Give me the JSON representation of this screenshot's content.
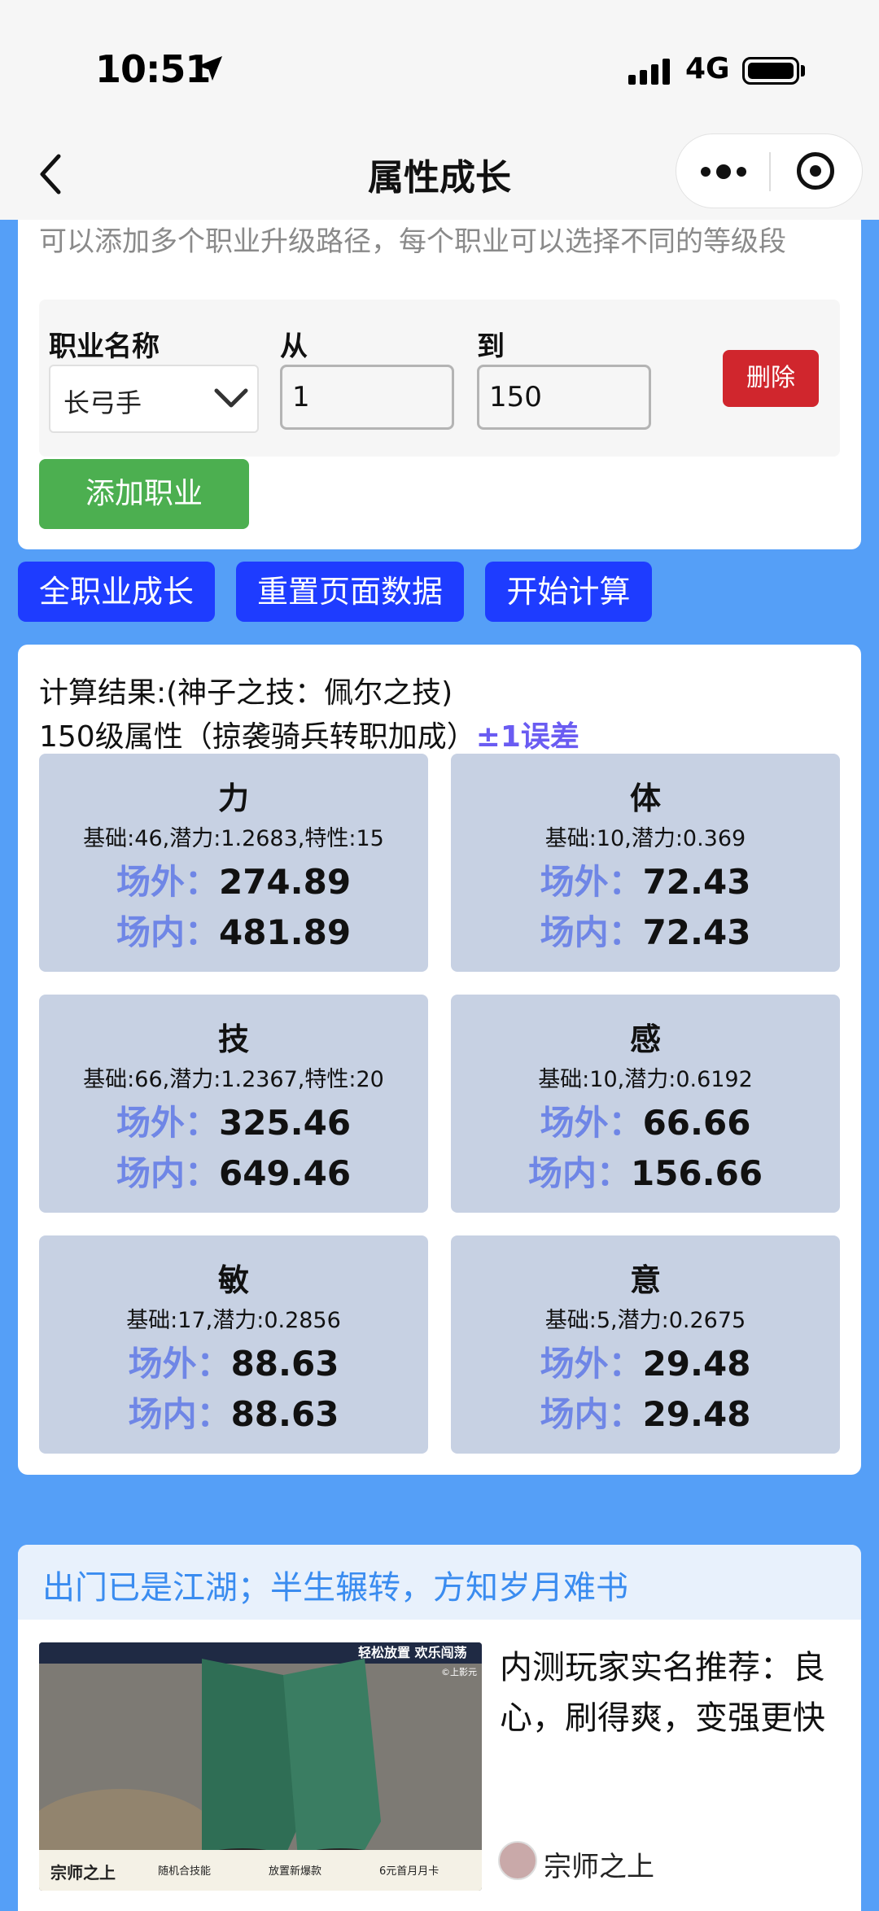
{
  "status_bar": {
    "time": "10:51",
    "network": "4G"
  },
  "nav": {
    "title": "属性成长"
  },
  "form": {
    "description": "可以添加多个职业升级路径，每个职业可以选择不同的等级段",
    "job_label": "职业名称",
    "from_label": "从",
    "to_label": "到",
    "job_value": "长弓手",
    "from_value": "1",
    "to_value": "150",
    "delete_label": "删除",
    "add_label": "添加职业"
  },
  "actions": {
    "all_growth": "全职业成长",
    "reset": "重置页面数据",
    "calculate": "开始计算"
  },
  "result": {
    "line1": "计算结果:(神子之技：佩尔之技)",
    "line2": "150级属性（掠袭骑兵转职加成）",
    "error_note": "±1误差",
    "outside_label": "场外：",
    "inside_label": "场内：",
    "stats": [
      {
        "name": "力",
        "base": "基础:46,潜力:1.2683,特性:15",
        "outside": "274.89",
        "inside": "481.89"
      },
      {
        "name": "体",
        "base": "基础:10,潜力:0.369",
        "outside": "72.43",
        "inside": "72.43"
      },
      {
        "name": "技",
        "base": "基础:66,潜力:1.2367,特性:20",
        "outside": "325.46",
        "inside": "649.46"
      },
      {
        "name": "感",
        "base": "基础:10,潜力:0.6192",
        "outside": "66.66",
        "inside": "156.66"
      },
      {
        "name": "敏",
        "base": "基础:17,潜力:0.2856",
        "outside": "88.63",
        "inside": "88.63"
      },
      {
        "name": "意",
        "base": "基础:5,潜力:0.2675",
        "outside": "29.48",
        "inside": "29.48"
      }
    ]
  },
  "ad": {
    "heading": "出门已是江湖；半生辗转，方知岁月难书",
    "text": "内测玩家实名推荐：良心，刷得爽，变强更快",
    "author": "宗师之上",
    "image_texts": [
      "轻松放置 欢乐闯荡",
      "宗师之上",
      "随机合技能",
      "放置新爆款",
      "6元首月月卡",
      "©上影元"
    ]
  }
}
